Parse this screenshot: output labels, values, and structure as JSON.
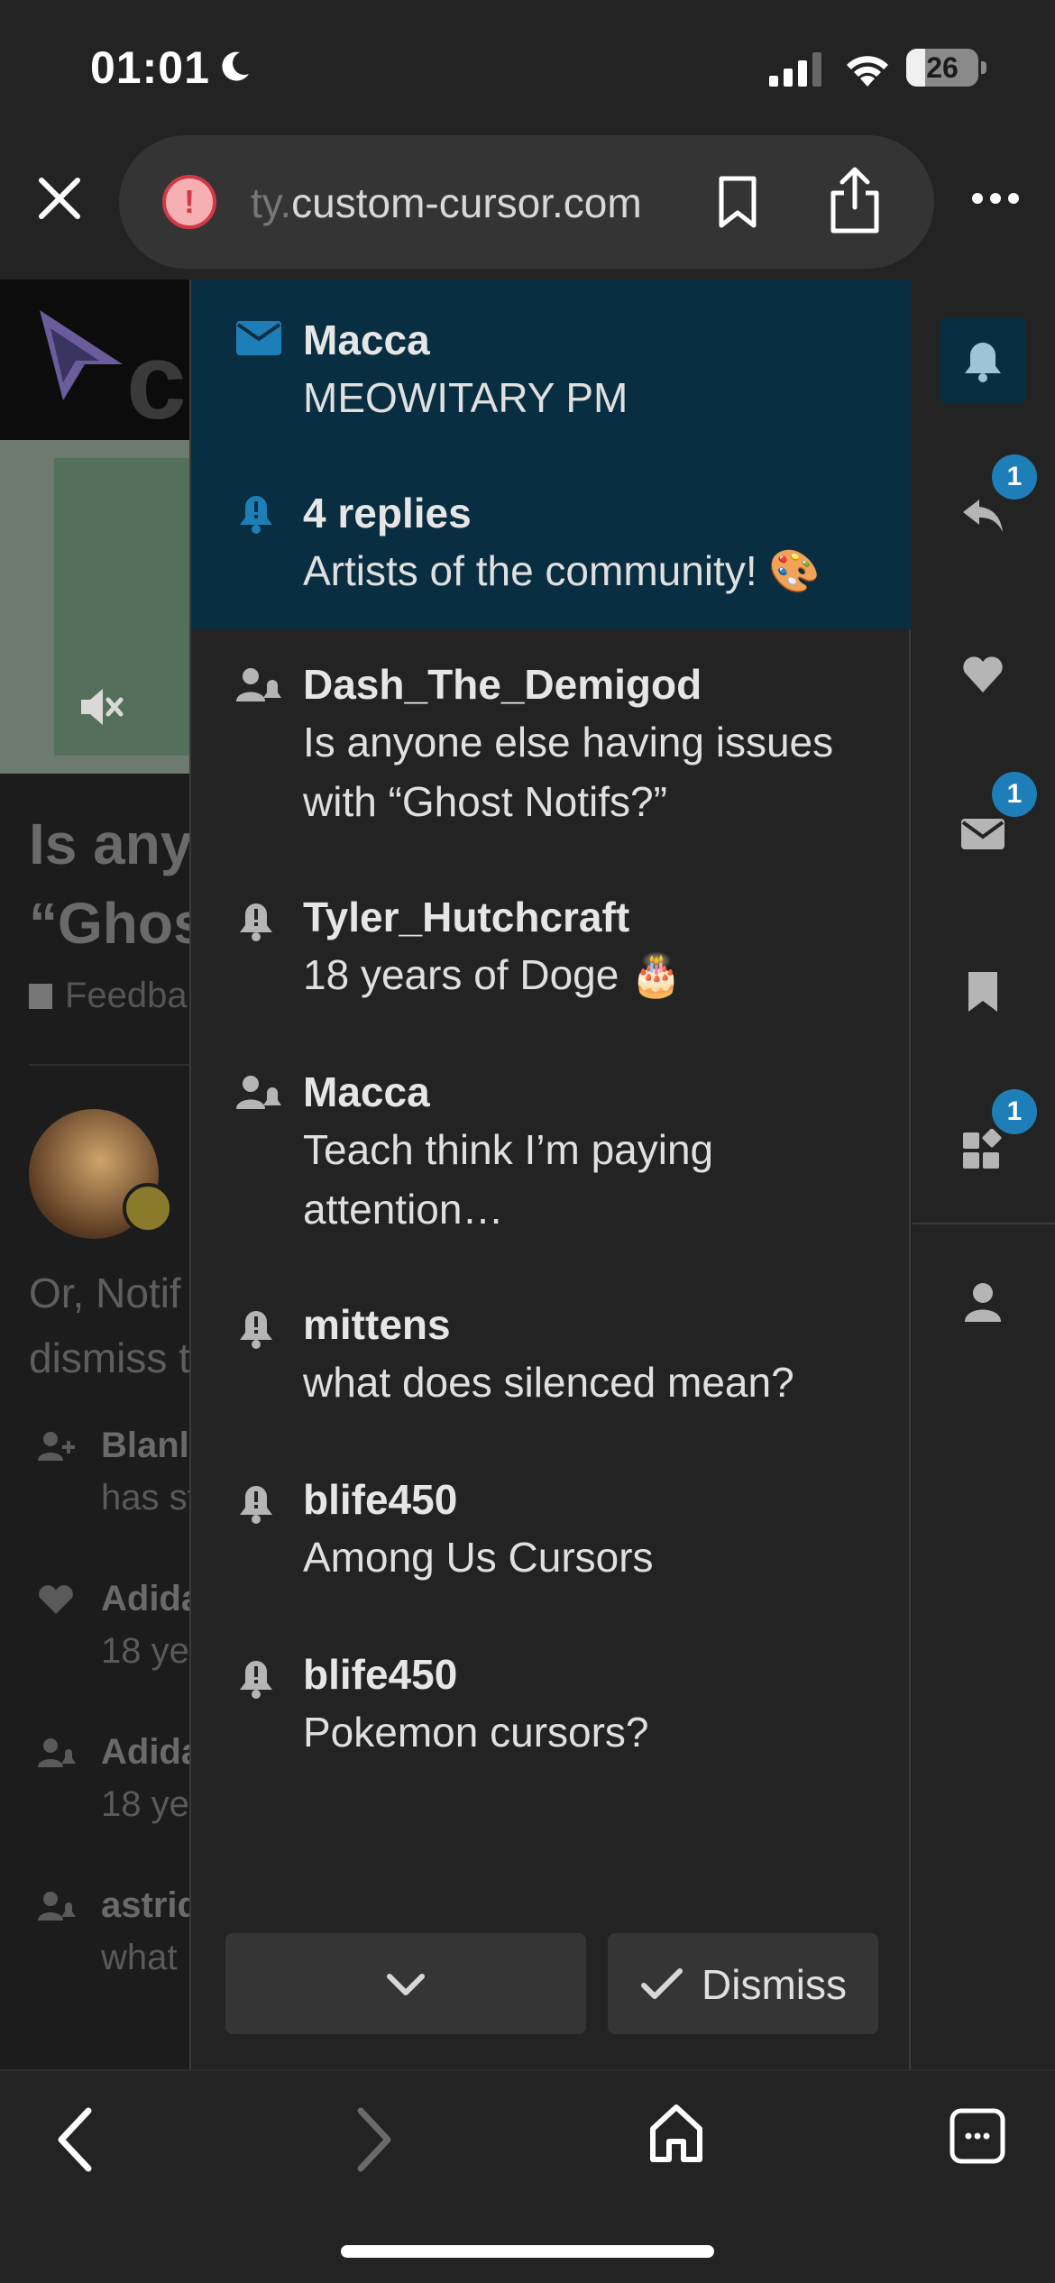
{
  "status_bar": {
    "time": "01:01",
    "battery": "26",
    "battery_level": 0.26
  },
  "browser": {
    "url_faded": "ty.",
    "url_main": "custom-cursor.com",
    "icons": [
      "close-icon",
      "warning-icon",
      "bookmark-icon",
      "share-icon",
      "more-icon"
    ]
  },
  "background_page": {
    "title_line1": "Is any",
    "title_line2": "“Ghos",
    "category": "Feedba",
    "post_line1": "Or, Notif",
    "post_line2": "dismiss t",
    "notifs": [
      {
        "user": "Blanl",
        "text": "has st"
      },
      {
        "user": "Adida",
        "text": "18 ye"
      },
      {
        "user": "Adida",
        "text": "18 ye"
      },
      {
        "user": "astrid",
        "text": "what"
      }
    ]
  },
  "notifications": [
    {
      "icon": "envelope-icon",
      "user": "Macca",
      "message": "MEOWITARY PM",
      "unread": true
    },
    {
      "icon": "bell-icon",
      "user": "4 replies",
      "message": "Artists of the community! 🎨",
      "unread": true
    },
    {
      "icon": "user-bell-icon",
      "user": "Dash_The_Demigod",
      "message": "Is anyone else having issues with “Ghost Notifs?”",
      "unread": false
    },
    {
      "icon": "bell-icon",
      "user": "Tyler_Hutchcraft",
      "message": "18 years of Doge 🎂",
      "unread": false
    },
    {
      "icon": "user-bell-icon",
      "user": "Macca",
      "message": "Teach think I’m paying attention…",
      "unread": false
    },
    {
      "icon": "bell-icon",
      "user": "mittens",
      "message": "what does silenced mean?",
      "unread": false
    },
    {
      "icon": "bell-icon",
      "user": "blife450",
      "message": "Among Us Cursors",
      "unread": false
    },
    {
      "icon": "bell-icon",
      "user": "blife450",
      "message": "Pokemon cursors?",
      "unread": false
    }
  ],
  "footer": {
    "dismiss_label": "Dismiss"
  },
  "side_menu": [
    {
      "icon": "bell-icon",
      "active": true,
      "badge": ""
    },
    {
      "icon": "reply-icon",
      "active": false,
      "badge": "1"
    },
    {
      "icon": "heart-icon",
      "active": false,
      "badge": ""
    },
    {
      "icon": "envelope-icon",
      "active": false,
      "badge": "1"
    },
    {
      "icon": "bookmark-icon",
      "active": false,
      "badge": ""
    },
    {
      "icon": "widgets-icon",
      "active": false,
      "badge": "1"
    },
    {
      "icon": "user-icon",
      "active": false,
      "badge": ""
    }
  ],
  "colors": {
    "unread_bg": "#0a2e41",
    "accent": "#1e7fb8",
    "panel_bg": "#232323"
  }
}
